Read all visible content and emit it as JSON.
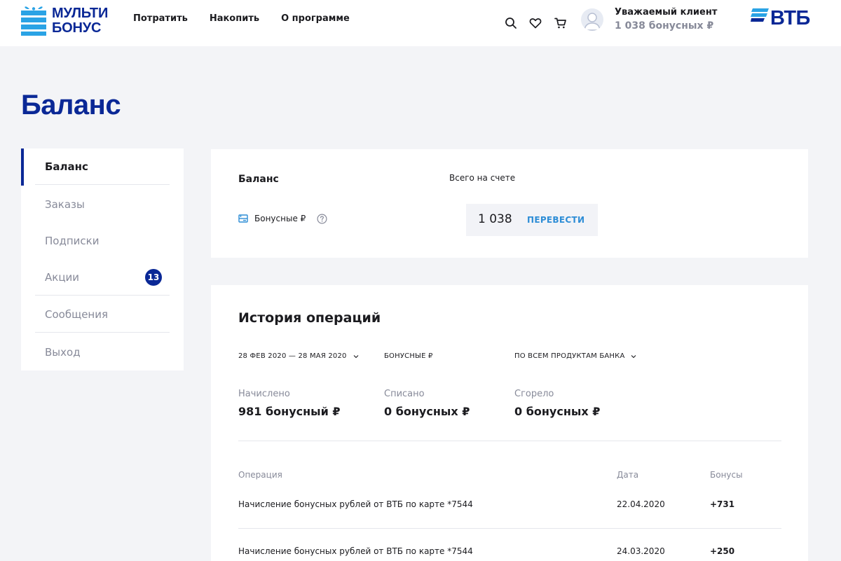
{
  "header": {
    "logo_line1": "МУЛЬТИ",
    "logo_line2": "БОНУС",
    "nav": [
      {
        "label": "Потратить"
      },
      {
        "label": "Накопить"
      },
      {
        "label": "О программе"
      }
    ],
    "user_name": "Уважаемый клиент",
    "user_balance": "1 038 бонусных ₽",
    "bank_logo": "ВТБ",
    "icons": [
      "search-icon",
      "heart-icon",
      "cart-icon",
      "avatar-icon"
    ]
  },
  "page": {
    "title": "Баланс"
  },
  "sidebar": {
    "items": [
      {
        "label": "Баланс",
        "active": true
      },
      {
        "label": "Заказы"
      },
      {
        "label": "Подписки"
      },
      {
        "label": "Акции",
        "badge": "13"
      },
      {
        "label": "Сообщения"
      },
      {
        "label": "Выход"
      }
    ]
  },
  "balance": {
    "title": "Баланс",
    "total_label": "Всего на счете",
    "row_label": "Бонусные ₽",
    "value": "1 038",
    "transfer_label": "ПЕРЕВЕСТИ"
  },
  "history": {
    "title": "История операций",
    "filters": {
      "period": "28 ФЕВ 2020 — 28 МАЯ 2020",
      "currency": "БОНУСНЫЕ ₽",
      "products": "ПО ВСЕМ ПРОДУКТАМ БАНКА"
    },
    "stats": [
      {
        "label": "Начислено",
        "value": "981 бонусный ₽"
      },
      {
        "label": "Списано",
        "value": "0 бонусных ₽"
      },
      {
        "label": "Сгорело",
        "value": "0 бонусных ₽"
      }
    ],
    "columns": {
      "operation": "Операция",
      "date": "Дата",
      "bonuses": "Бонусы"
    },
    "rows": [
      {
        "operation": "Начисление бонусных рублей от ВТБ по карте *7544",
        "date": "22.04.2020",
        "bonuses": "+731"
      },
      {
        "operation": "Начисление бонусных рублей от ВТБ по карте *7544",
        "date": "24.03.2020",
        "bonuses": "+250"
      }
    ]
  },
  "colors": {
    "brand_blue": "#0a2896",
    "accent_blue": "#2d8dd6",
    "logo_light_blue": "#2aa3e5",
    "muted_text": "#878a99",
    "page_bg": "#f3f4f7"
  }
}
